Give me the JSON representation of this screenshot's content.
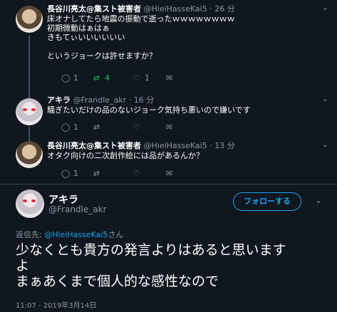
{
  "tweets": [
    {
      "name": "長谷川亮太@集スト被害者",
      "handle": "@HieiHasseKai5",
      "time": "· 26 分",
      "text": "床オナしてたら地震の振動で逝ったｗｗｗｗｗｗｗｗ\n初期微動はぁはぁ\nきもてぃいいいいいい\n\nというジョークは許せますか？",
      "reply_count": "1",
      "retweet_count": "4",
      "like_count": "1"
    },
    {
      "name": "アキラ",
      "handle": "@Frandle_akr",
      "time": "· 16 分",
      "text": "騒ぎたいだけの品のないジョーク気持ち悪いので嫌いです",
      "reply_count": "1",
      "retweet_count": "",
      "like_count": ""
    },
    {
      "name": "長谷川亮太@集スト被害者",
      "handle": "@HieiHasseKai5",
      "time": "· 13 分",
      "text": "オタク向けの二次創作絵には品があるんか？",
      "reply_count": "1",
      "retweet_count": "",
      "like_count": ""
    }
  ],
  "main": {
    "name": "アキラ",
    "handle": "@Frandle_akr",
    "follow_label": "フォローする",
    "reply_to_label": "返信先:",
    "reply_to_handle": "@HieiHasseKai5",
    "reply_to_suffix": "さん",
    "text": "少なくとも貴方の発言よりはあると思います\nよ\nまぁあくまで個人的な感性なので",
    "timestamp": "11:07 - 2019年3月14日"
  },
  "icons": {
    "reply": "reply-icon",
    "retweet": "retweet-icon",
    "like": "heart-icon",
    "dm": "envelope-icon",
    "menu": "chevron-down-icon",
    "more": "chevron-down-icon"
  },
  "colors": {
    "background": "#10171e",
    "accent": "#1da1f2",
    "retweet": "#17bf63",
    "muted": "#8899a6"
  }
}
